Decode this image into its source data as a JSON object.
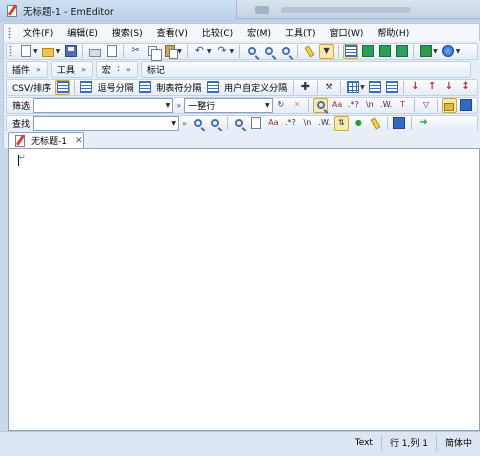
{
  "window": {
    "title": "无标题-1 - EmEditor"
  },
  "menu": {
    "items": [
      "文件(F)",
      "编辑(E)",
      "搜索(S)",
      "查看(V)",
      "比较(C)",
      "宏(M)",
      "工具(T)",
      "窗口(W)",
      "帮助(H)"
    ]
  },
  "toolbars": {
    "plugins_label": "插件",
    "tools_label": "工具",
    "macro_label": "宏",
    "markers_label": "标记",
    "csv_label": "CSV/排序",
    "comma_sep": "逗号分隔",
    "tab_sep": "制表符分隔",
    "user_sep": "用户自定义分隔",
    "filter_label": "筛选",
    "find_label": "查找",
    "filter_mode": "一整行",
    "filter_value": "",
    "find_value": ""
  },
  "tabs": [
    {
      "label": "无标题-1"
    }
  ],
  "status": {
    "mode": "Text",
    "position": "行 1,列 1",
    "encoding": "简体中"
  },
  "colors": {
    "accent": "#2f69c4",
    "active_button": "#f7e8b0"
  }
}
